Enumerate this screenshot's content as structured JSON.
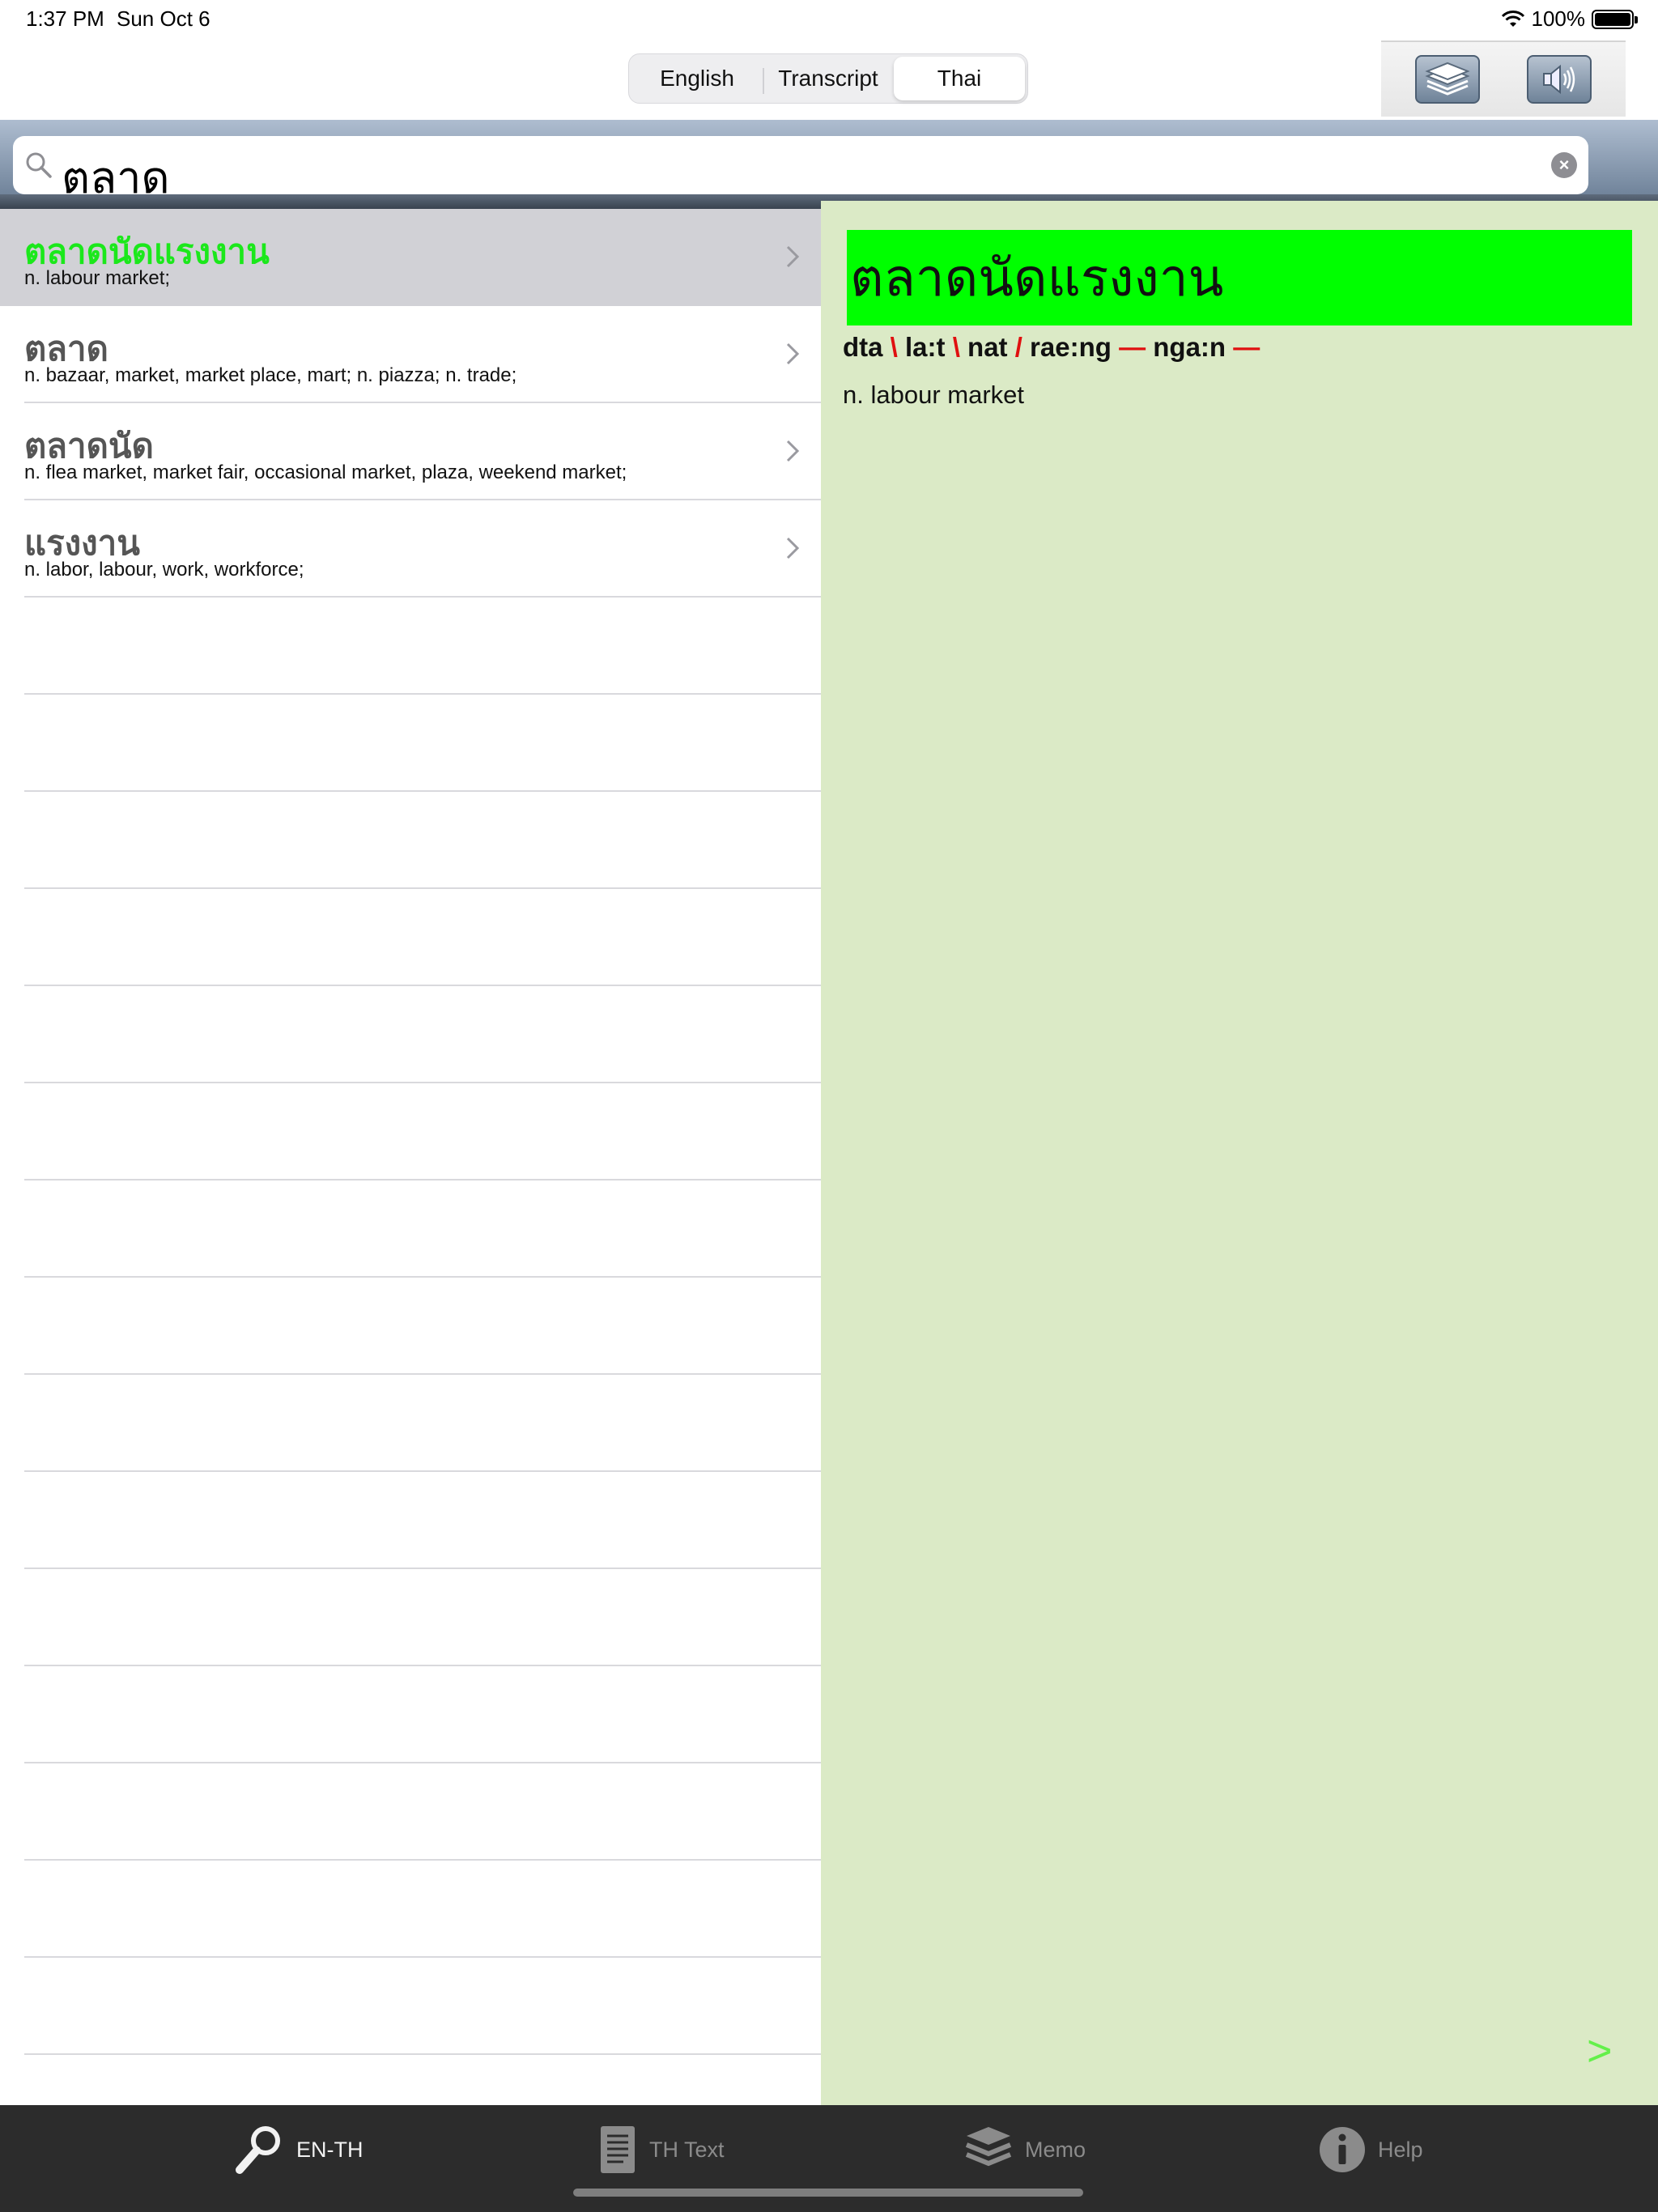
{
  "status_bar": {
    "time": "1:37 PM",
    "date": "Sun Oct 6",
    "battery": "100%"
  },
  "toolbar": {
    "segments": [
      "English",
      "Transcript",
      "Thai"
    ],
    "active_segment": "Thai",
    "layers_icon": "layers-icon",
    "sound_icon": "speaker-icon"
  },
  "search": {
    "query": "ตลาด"
  },
  "results": [
    {
      "thai": "ตลาดนัดแรงงาน",
      "gloss": "n. labour market;",
      "selected": true
    },
    {
      "thai": "ตลาด",
      "gloss": "n. bazaar, market, market place, mart; n. piazza; n. trade;",
      "selected": false
    },
    {
      "thai": "ตลาดนัด",
      "gloss": "n. flea market, market fair, occasional market, plaza, weekend market;",
      "selected": false
    },
    {
      "thai": "แรงงาน",
      "gloss": "n. labor, labour, work, workforce;",
      "selected": false
    }
  ],
  "detail": {
    "title": "ตลาดนัดแรงงาน",
    "syllables": [
      {
        "text": "dta",
        "tone": "\\"
      },
      {
        "text": "la:t",
        "tone": "\\"
      },
      {
        "text": "nat",
        "tone": "/"
      },
      {
        "text": "rae:ng",
        "tone": "—"
      },
      {
        "text": "nga:n",
        "tone": "—"
      }
    ],
    "definition": "n. labour market",
    "next": ">"
  },
  "tabbar": {
    "items": [
      {
        "label": "EN-TH",
        "icon": "magnifier-icon",
        "active": true
      },
      {
        "label": "TH Text",
        "icon": "document-icon",
        "active": false
      },
      {
        "label": "Memo",
        "icon": "layers-icon",
        "active": false
      },
      {
        "label": "Help",
        "icon": "info-icon",
        "active": false
      }
    ]
  },
  "colors": {
    "selected_text": "#1be81b",
    "title_highlight": "#00ff00",
    "detail_background": "#dbeac6",
    "tone_mark": "#e01010",
    "tabbar_background": "#2c2c2c"
  }
}
